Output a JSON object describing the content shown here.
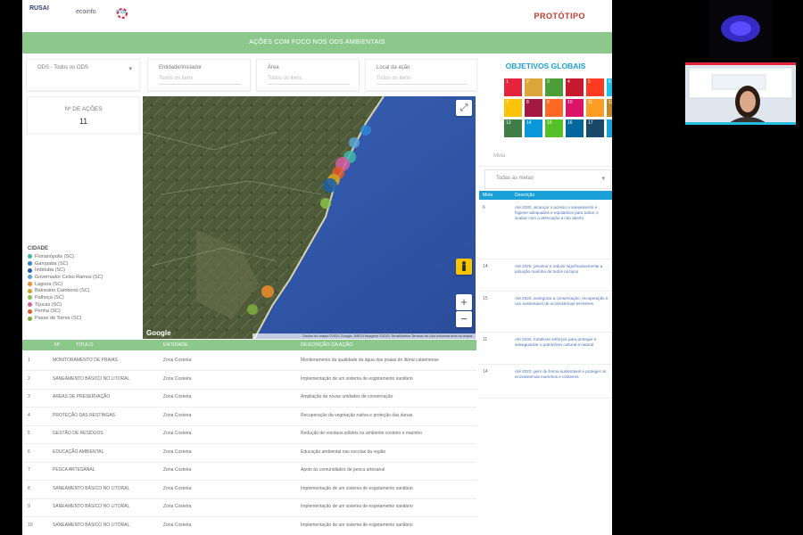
{
  "header": {
    "logos": [
      "RUSAI",
      "ecoinfo",
      "mar"
    ],
    "brand_label": "PROTÓTIPO"
  },
  "banner": {
    "text": "AÇÕES COM FOCO NOS ODS AMBIENTAIS"
  },
  "filters": [
    {
      "label": "ODS - Todos os ODS",
      "placeholder": ""
    },
    {
      "label": "Entidade/Iniciador",
      "placeholder": "Todos os itens"
    },
    {
      "label": "Área",
      "placeholder": "Todos os itens"
    },
    {
      "label": "Local da ação",
      "placeholder": "Todos os itens"
    }
  ],
  "count_box": {
    "label": "Nº DE AÇÕES",
    "value": "11"
  },
  "legend": {
    "title": "CIDADE",
    "items": [
      {
        "label": "Florianópolis (SC)",
        "color": "#3fb6a8"
      },
      {
        "label": "Garopaba (SC)",
        "color": "#2e86d1"
      },
      {
        "label": "Imbituba (SC)",
        "color": "#1b5fa8"
      },
      {
        "label": "Governador Celso Ramos (SC)",
        "color": "#5aa3d6"
      },
      {
        "label": "Laguna (SC)",
        "color": "#f08c2a"
      },
      {
        "label": "Balneário Camboriú (SC)",
        "color": "#cfa51e"
      },
      {
        "label": "Palhoça (SC)",
        "color": "#8bc34a"
      },
      {
        "label": "Tijucas (SC)",
        "color": "#d55ea0"
      },
      {
        "label": "Penha (SC)",
        "color": "#e05a2b"
      },
      {
        "label": "Passo de Torres (SC)",
        "color": "#7fae3d"
      }
    ]
  },
  "map": {
    "provider": "Google",
    "attribution": "Dados do mapa ©2021 Google, INEGI Imagens ©2021 TerraMetrics Termos de Uso Informar erro no mapa",
    "zoom_in": "+",
    "zoom_out": "−",
    "fullscreen_icon": "⤢",
    "pegman_icon": "🚶",
    "markers": [
      {
        "color": "#2e86d1"
      },
      {
        "color": "#5aa3d6"
      },
      {
        "color": "#3fb6a8"
      },
      {
        "color": "#d55ea0"
      },
      {
        "color": "#e05a2b"
      },
      {
        "color": "#cfa51e"
      },
      {
        "color": "#1b5fa8"
      },
      {
        "color": "#8bc34a"
      },
      {
        "color": "#f08c2a"
      },
      {
        "color": "#7fae3d"
      }
    ]
  },
  "table": {
    "headers": [
      "Nº",
      "TÍTULO",
      "ENTIDADE",
      "DESCRIÇÃO DA AÇÃO"
    ],
    "rows": [
      {
        "num": "1",
        "title": "MONITORAMENTO DE PRAIAS",
        "entity": "Zona Costeira",
        "desc": "Monitoramento da qualidade da água das praias do litoral catarinense"
      },
      {
        "num": "2",
        "title": "SANEAMENTO BÁSICO NO LITORAL",
        "entity": "Zona Costeira",
        "desc": "Implementação de um sistema de esgotamento sanitário"
      },
      {
        "num": "3",
        "title": "ÁREAS DE PRESERVAÇÃO",
        "entity": "Zona Costeira",
        "desc": "Ampliação de novas unidades de conservação"
      },
      {
        "num": "4",
        "title": "PROTEÇÃO DAS RESTINGAS",
        "entity": "Zona Costeira",
        "desc": "Recuperação da vegetação nativa e proteção das dunas"
      },
      {
        "num": "5",
        "title": "GESTÃO DE RESÍDUOS",
        "entity": "Zona Costeira",
        "desc": "Redução de resíduos sólidos no ambiente costeiro e marinho"
      },
      {
        "num": "6",
        "title": "EDUCAÇÃO AMBIENTAL",
        "entity": "Zona Costeira",
        "desc": "Educação ambiental nas escolas da região"
      },
      {
        "num": "7",
        "title": "PESCA ARTESANAL",
        "entity": "Zona Costeira",
        "desc": "Apoio às comunidades de pesca artesanal"
      },
      {
        "num": "8",
        "title": "SANEAMENTO BÁSICO NO LITORAL",
        "entity": "Zona Costeira",
        "desc": "Implementação de um sistema de esgotamento sanitário"
      },
      {
        "num": "9",
        "title": "SANEAMENTO BÁSICO NO LITORAL",
        "entity": "Zona Costeira",
        "desc": "Implementação de um sistema de esgotamento sanitário"
      },
      {
        "num": "10",
        "title": "SANEAMENTO BÁSICO NO LITORAL",
        "entity": "Zona Costeira",
        "desc": "Implementação de um sistema de esgotamento sanitário"
      }
    ]
  },
  "sdg": {
    "title": "OBJETIVOS GLOBAIS",
    "tiles": [
      {
        "n": "1",
        "color": "#e5243b"
      },
      {
        "n": "2",
        "color": "#dda63a"
      },
      {
        "n": "3",
        "color": "#4c9f38"
      },
      {
        "n": "4",
        "color": "#c5192d"
      },
      {
        "n": "5",
        "color": "#ff3a21"
      },
      {
        "n": "6",
        "color": "#26bde2"
      },
      {
        "n": "7",
        "color": "#fcc30b"
      },
      {
        "n": "8",
        "color": "#a21942"
      },
      {
        "n": "9",
        "color": "#fd6925"
      },
      {
        "n": "10",
        "color": "#dd1367"
      },
      {
        "n": "11",
        "color": "#fd9d24"
      },
      {
        "n": "12",
        "color": "#bf8b2e"
      },
      {
        "n": "13",
        "color": "#3f7e44"
      },
      {
        "n": "14",
        "color": "#0a97d9"
      },
      {
        "n": "15",
        "color": "#56c02b"
      },
      {
        "n": "16",
        "color": "#00689d"
      },
      {
        "n": "17",
        "color": "#19486a"
      },
      {
        "n": "",
        "color": "#1a9fd6"
      }
    ]
  },
  "side": {
    "search_placeholder": "Meta",
    "select_value": "Todas as metas",
    "select_chevron": "▾",
    "headers": [
      "Meta",
      "Descrição"
    ],
    "rows": [
      {
        "n": "6",
        "text": "Até 2030, alcançar o acesso a saneamento e higiene adequados e equitativos para todos, e acabar com a defecação a céu aberto"
      },
      {
        "n": "14",
        "text": "Até 2025, prevenir e reduzir significativamente a poluição marinha de todos os tipos"
      },
      {
        "n": "15",
        "text": "Até 2020, assegurar a conservação, recuperação e uso sustentável de ecossistemas terrestres"
      },
      {
        "n": "11",
        "text": "Até 2030, fortalecer esforços para proteger e salvaguardar o patrimônio cultural e natural"
      },
      {
        "n": "14",
        "text": "Até 2020, gerir de forma sustentável e proteger os ecossistemas marinhos e costeiros"
      }
    ]
  }
}
